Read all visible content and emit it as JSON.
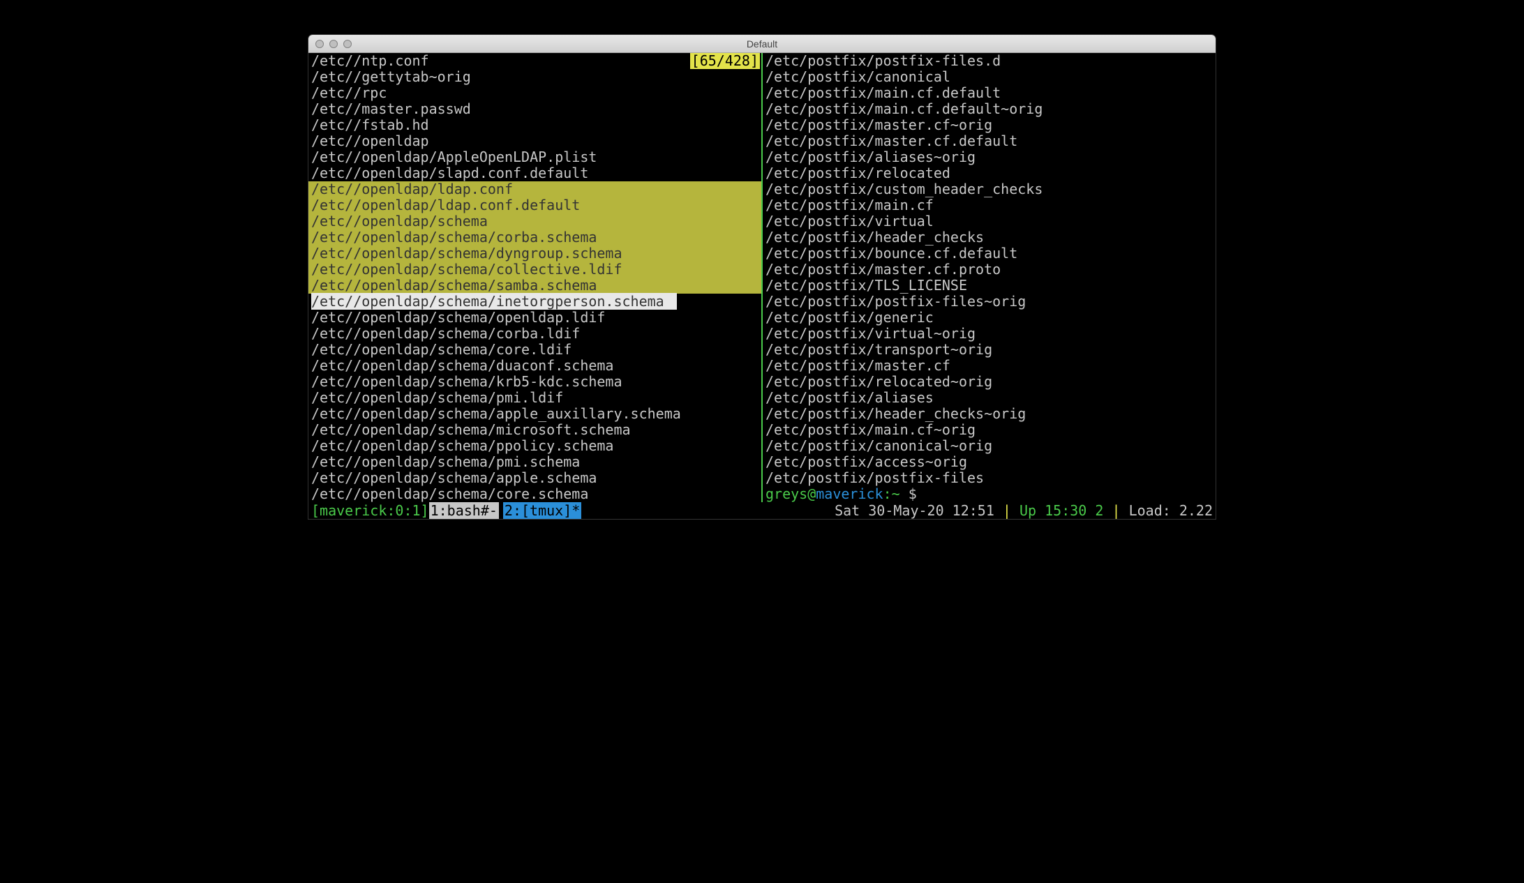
{
  "window": {
    "title": "Default"
  },
  "counter": "[65/428]",
  "left_pane": {
    "before_highlight": [
      "/etc//ntp.conf",
      "/etc//gettytab~orig",
      "/etc//rpc",
      "/etc//master.passwd",
      "/etc//fstab.hd",
      "/etc//openldap",
      "/etc//openldap/AppleOpenLDAP.plist",
      "/etc//openldap/slapd.conf.default"
    ],
    "highlight_block": [
      "/etc//openldap/ldap.conf",
      "/etc//openldap/ldap.conf.default",
      "/etc//openldap/schema",
      "/etc//openldap/schema/corba.schema",
      "/etc//openldap/schema/dyngroup.schema",
      "/etc//openldap/schema/collective.ldif",
      "/etc//openldap/schema/samba.schema"
    ],
    "cursor_line": "/etc//openldap/schema/inetorgperson.schema ",
    "after_highlight": [
      "/etc//openldap/schema/openldap.ldif",
      "/etc//openldap/schema/corba.ldif",
      "/etc//openldap/schema/core.ldif",
      "/etc//openldap/schema/duaconf.schema",
      "/etc//openldap/schema/krb5-kdc.schema",
      "/etc//openldap/schema/pmi.ldif",
      "/etc//openldap/schema/apple_auxillary.schema",
      "/etc//openldap/schema/microsoft.schema",
      "/etc//openldap/schema/ppolicy.schema",
      "/etc//openldap/schema/pmi.schema",
      "/etc//openldap/schema/apple.schema",
      "/etc//openldap/schema/core.schema"
    ]
  },
  "right_pane": {
    "lines": [
      "/etc/postfix/postfix-files.d",
      "/etc/postfix/canonical",
      "/etc/postfix/main.cf.default",
      "/etc/postfix/main.cf.default~orig",
      "/etc/postfix/master.cf~orig",
      "/etc/postfix/master.cf.default",
      "/etc/postfix/aliases~orig",
      "/etc/postfix/relocated",
      "/etc/postfix/custom_header_checks",
      "/etc/postfix/main.cf",
      "/etc/postfix/virtual",
      "/etc/postfix/header_checks",
      "/etc/postfix/bounce.cf.default",
      "/etc/postfix/master.cf.proto",
      "/etc/postfix/TLS_LICENSE",
      "/etc/postfix/postfix-files~orig",
      "/etc/postfix/generic",
      "/etc/postfix/virtual~orig",
      "/etc/postfix/transport~orig",
      "/etc/postfix/master.cf",
      "/etc/postfix/relocated~orig",
      "/etc/postfix/aliases",
      "/etc/postfix/header_checks~orig",
      "/etc/postfix/main.cf~orig",
      "/etc/postfix/canonical~orig",
      "/etc/postfix/access~orig",
      "/etc/postfix/postfix-files"
    ],
    "prompt": {
      "user": "greys",
      "at": "@",
      "host": "maverick",
      "path": ":~ ",
      "dollar": "$"
    }
  },
  "statusbar": {
    "session": "maverick:0:1",
    "tab1": "1:bash#-",
    "tab2": "2:[tmux]*",
    "datetime": "Sat 30-May-20 12:51",
    "uptime_label": "Up ",
    "uptime_value": "15:30 2",
    "load_label": "Load: ",
    "load_value": "2.22"
  }
}
